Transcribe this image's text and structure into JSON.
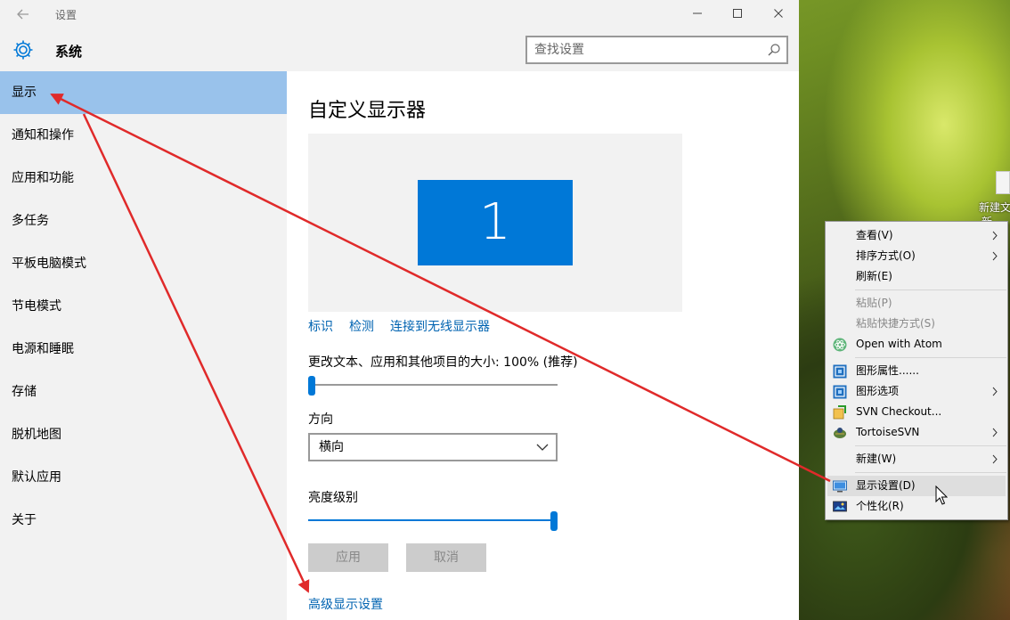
{
  "desktop": {
    "icon_label_line1": "新建文",
    "icon_label_line2": "新"
  },
  "window": {
    "title": "设置",
    "back_icon": "back-arrow-icon",
    "controls": {
      "minimize": "—",
      "maximize": "☐",
      "close": "✕"
    }
  },
  "header": {
    "title": "系统",
    "search_placeholder": "查找设置"
  },
  "sidebar": {
    "items": [
      {
        "label": "显示",
        "active": true
      },
      {
        "label": "通知和操作"
      },
      {
        "label": "应用和功能"
      },
      {
        "label": "多任务"
      },
      {
        "label": "平板电脑模式"
      },
      {
        "label": "节电模式"
      },
      {
        "label": "电源和睡眠"
      },
      {
        "label": "存储"
      },
      {
        "label": "脱机地图"
      },
      {
        "label": "默认应用"
      },
      {
        "label": "关于"
      }
    ]
  },
  "main": {
    "title": "自定义显示器",
    "monitor_number": "1",
    "links": {
      "identify": "标识",
      "detect": "检测",
      "wireless": "连接到无线显示器"
    },
    "scale_label": "更改文本、应用和其他项目的大小: 100% (推荐)",
    "scale_value": 0,
    "orientation_label": "方向",
    "orientation_value": "横向",
    "brightness_label": "亮度级别",
    "brightness_value": 1,
    "apply_label": "应用",
    "cancel_label": "取消",
    "advanced_link": "高级显示设置"
  },
  "context_menu": {
    "items": [
      {
        "label": "查看(V)",
        "submenu": true
      },
      {
        "label": "排序方式(O)",
        "submenu": true
      },
      {
        "label": "刷新(E)"
      },
      {
        "separator": true
      },
      {
        "label": "粘贴(P)",
        "disabled": true
      },
      {
        "label": "粘贴快捷方式(S)",
        "disabled": true
      },
      {
        "label": "Open with Atom",
        "icon": "atom-icon"
      },
      {
        "separator": true
      },
      {
        "label": "图形属性......",
        "icon": "intel-graphics-icon"
      },
      {
        "label": "图形选项",
        "icon": "intel-graphics-icon",
        "submenu": true
      },
      {
        "label": "SVN Checkout...",
        "icon": "svn-checkout-icon"
      },
      {
        "label": "TortoiseSVN",
        "icon": "tortoisesvn-icon",
        "submenu": true
      },
      {
        "separator": true
      },
      {
        "label": "新建(W)",
        "submenu": true
      },
      {
        "separator": true
      },
      {
        "label": "显示设置(D)",
        "icon": "display-settings-icon",
        "hover": true
      },
      {
        "label": "个性化(R)",
        "icon": "personalize-icon"
      }
    ]
  },
  "colors": {
    "accent": "#0078d7",
    "sidebar_active": "#99c2eb",
    "link": "#0063b1",
    "arrow": "#e02a2a"
  }
}
